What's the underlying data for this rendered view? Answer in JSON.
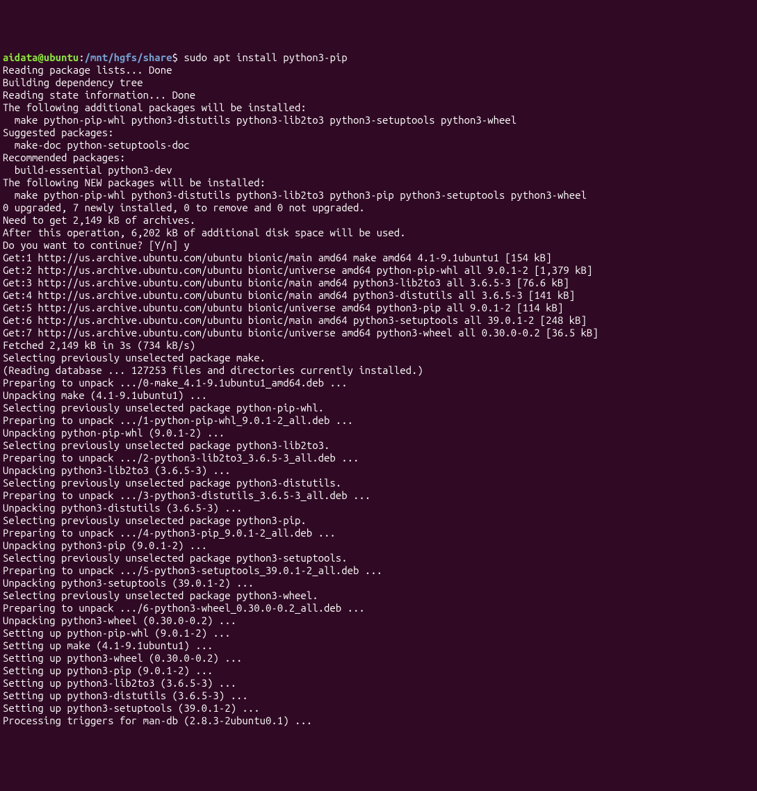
{
  "prompt": {
    "user": "aidata@ubuntu",
    "colon": ":",
    "path": "/mnt/hgfs/share",
    "dollar": "$ "
  },
  "command": "sudo apt install python3-pip",
  "lines": [
    "Reading package lists... Done",
    "Building dependency tree",
    "Reading state information... Done",
    "The following additional packages will be installed:",
    "  make python-pip-whl python3-distutils python3-lib2to3 python3-setuptools python3-wheel",
    "Suggested packages:",
    "  make-doc python-setuptools-doc",
    "Recommended packages:",
    "  build-essential python3-dev",
    "The following NEW packages will be installed:",
    "  make python-pip-whl python3-distutils python3-lib2to3 python3-pip python3-setuptools python3-wheel",
    "0 upgraded, 7 newly installed, 0 to remove and 0 not upgraded.",
    "Need to get 2,149 kB of archives.",
    "After this operation, 6,202 kB of additional disk space will be used.",
    "Do you want to continue? [Y/n] y",
    "Get:1 http://us.archive.ubuntu.com/ubuntu bionic/main amd64 make amd64 4.1-9.1ubuntu1 [154 kB]",
    "Get:2 http://us.archive.ubuntu.com/ubuntu bionic/universe amd64 python-pip-whl all 9.0.1-2 [1,379 kB]",
    "Get:3 http://us.archive.ubuntu.com/ubuntu bionic/main amd64 python3-lib2to3 all 3.6.5-3 [76.6 kB]",
    "Get:4 http://us.archive.ubuntu.com/ubuntu bionic/main amd64 python3-distutils all 3.6.5-3 [141 kB]",
    "Get:5 http://us.archive.ubuntu.com/ubuntu bionic/universe amd64 python3-pip all 9.0.1-2 [114 kB]",
    "Get:6 http://us.archive.ubuntu.com/ubuntu bionic/main amd64 python3-setuptools all 39.0.1-2 [248 kB]",
    "Get:7 http://us.archive.ubuntu.com/ubuntu bionic/universe amd64 python3-wheel all 0.30.0-0.2 [36.5 kB]",
    "Fetched 2,149 kB in 3s (734 kB/s)",
    "Selecting previously unselected package make.",
    "(Reading database ... 127253 files and directories currently installed.)",
    "Preparing to unpack .../0-make_4.1-9.1ubuntu1_amd64.deb ...",
    "Unpacking make (4.1-9.1ubuntu1) ...",
    "Selecting previously unselected package python-pip-whl.",
    "Preparing to unpack .../1-python-pip-whl_9.0.1-2_all.deb ...",
    "Unpacking python-pip-whl (9.0.1-2) ...",
    "Selecting previously unselected package python3-lib2to3.",
    "Preparing to unpack .../2-python3-lib2to3_3.6.5-3_all.deb ...",
    "Unpacking python3-lib2to3 (3.6.5-3) ...",
    "Selecting previously unselected package python3-distutils.",
    "Preparing to unpack .../3-python3-distutils_3.6.5-3_all.deb ...",
    "Unpacking python3-distutils (3.6.5-3) ...",
    "Selecting previously unselected package python3-pip.",
    "Preparing to unpack .../4-python3-pip_9.0.1-2_all.deb ...",
    "Unpacking python3-pip (9.0.1-2) ...",
    "Selecting previously unselected package python3-setuptools.",
    "Preparing to unpack .../5-python3-setuptools_39.0.1-2_all.deb ...",
    "Unpacking python3-setuptools (39.0.1-2) ...",
    "Selecting previously unselected package python3-wheel.",
    "Preparing to unpack .../6-python3-wheel_0.30.0-0.2_all.deb ...",
    "Unpacking python3-wheel (0.30.0-0.2) ...",
    "Setting up python-pip-whl (9.0.1-2) ...",
    "Setting up make (4.1-9.1ubuntu1) ...",
    "Setting up python3-wheel (0.30.0-0.2) ...",
    "Setting up python3-pip (9.0.1-2) ...",
    "Setting up python3-lib2to3 (3.6.5-3) ...",
    "Setting up python3-distutils (3.6.5-3) ...",
    "Setting up python3-setuptools (39.0.1-2) ...",
    "Processing triggers for man-db (2.8.3-2ubuntu0.1) ..."
  ]
}
